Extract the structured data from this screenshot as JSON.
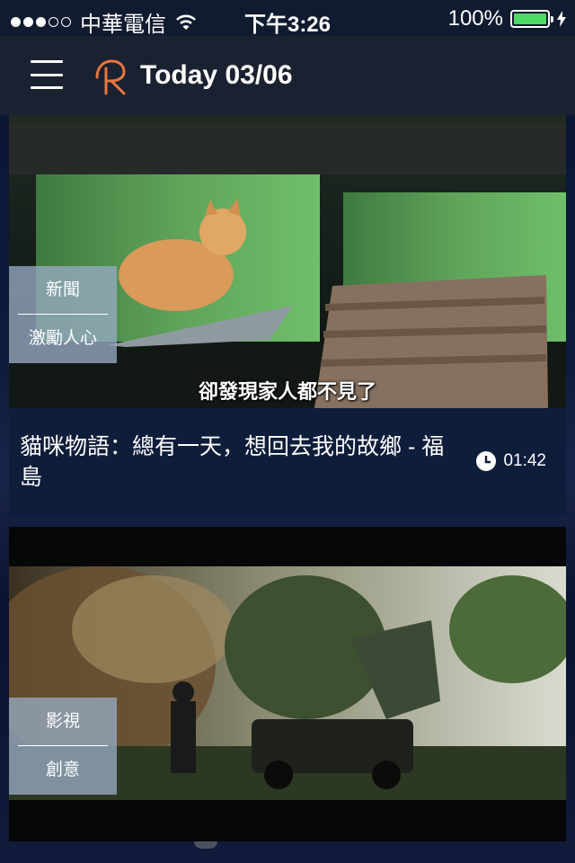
{
  "status_bar": {
    "carrier": "中華電信",
    "time": "下午3:26",
    "battery_percent": "100%",
    "signal_strength": 3,
    "signal_max": 5,
    "battery_level": 1.0
  },
  "header": {
    "logo_letter": "R",
    "title": "Today 03/06"
  },
  "videos": [
    {
      "tags": [
        "新聞",
        "激勵人心"
      ],
      "subtitle": "卻發現家人都不見了",
      "title": "貓咪物語：總有一天，想回去我的故鄉 - 福島",
      "duration": "01:42"
    },
    {
      "tags": [
        "影視",
        "創意"
      ]
    }
  ],
  "colors": {
    "logo_accent": "#e8773f",
    "battery_fill": "#4cd964",
    "nav_bar": "#1a2130",
    "tag_overlay": "#96aac3"
  }
}
